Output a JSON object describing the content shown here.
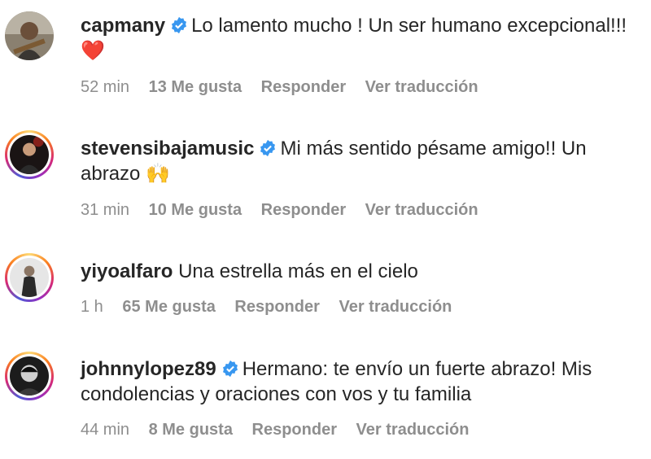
{
  "colors": {
    "verified": "#3897f0",
    "meta": "#8e8e8e",
    "text": "#262626",
    "heart": "#ed1c24"
  },
  "comments": [
    {
      "username": "capmany",
      "verified": true,
      "text": "Lo lamento mucho ! Un ser humano excepcional!!!",
      "emoji": "❤️",
      "time": "52 min",
      "likes": "13 Me gusta",
      "reply": "Responder",
      "translate": "Ver traducción",
      "has_story": false
    },
    {
      "username": "stevensibajamusic",
      "verified": true,
      "text": "Mi más sentido pésame amigo!! Un abrazo",
      "emoji": "🙌",
      "time": "31 min",
      "likes": "10 Me gusta",
      "reply": "Responder",
      "translate": "Ver traducción",
      "has_story": true
    },
    {
      "username": "yiyoalfaro",
      "verified": false,
      "text": "Una estrella más en el cielo",
      "emoji": "",
      "time": "1 h",
      "likes": "65 Me gusta",
      "reply": "Responder",
      "translate": "Ver traducción",
      "has_story": true
    },
    {
      "username": "johnnylopez89",
      "verified": true,
      "text": "Hermano: te envío un fuerte abrazo! Mis condolencias y oraciones con vos y tu familia",
      "emoji": "",
      "time": "44 min",
      "likes": "8 Me gusta",
      "reply": "Responder",
      "translate": "Ver traducción",
      "has_story": true
    }
  ]
}
